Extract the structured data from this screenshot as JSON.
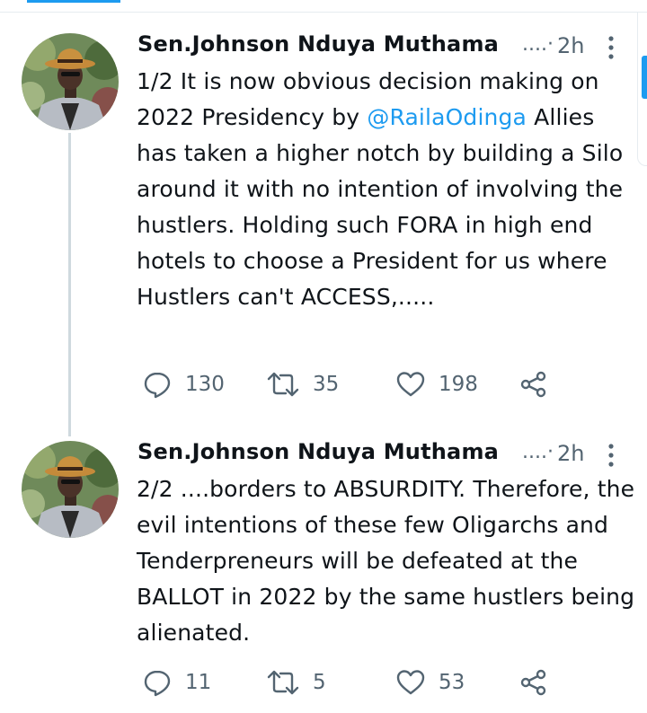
{
  "colors": {
    "accent": "#1d9bf0",
    "muted": "#536471",
    "text": "#0f1419",
    "thread_line": "#cfd9de"
  },
  "tweets": [
    {
      "author": "Sen.Johnson Nduya Muthama",
      "ellipsis": "....",
      "separator": "·",
      "time": "2h",
      "text_before": "1/2 It is now obvious decision making on 2022 Presidency by ",
      "mention": "@RailaOdinga",
      "text_after": " Allies has taken a higher notch by building a Silo around it with no intention of involving the hustlers. Holding such FORA in high end hotels to choose a President for us where Hustlers can't ACCESS,.....",
      "replies": "130",
      "retweets": "35",
      "likes": "198",
      "icons": [
        "reply-icon",
        "retweet-icon",
        "heart-icon",
        "share-icon",
        "more-vertical-icon"
      ]
    },
    {
      "author": "Sen.Johnson Nduya Muthama",
      "ellipsis": "....",
      "separator": "·",
      "time": "2h",
      "text_before": "2/2 ....borders to ABSURDITY. Therefore, the evil intentions of these few Oligarchs and Tenderpreneurs will be defeated at the BALLOT in 2022  by the same hustlers being alienated.",
      "mention": "",
      "text_after": "",
      "replies": "11",
      "retweets": "5",
      "likes": "53",
      "icons": [
        "reply-icon",
        "retweet-icon",
        "heart-icon",
        "share-icon",
        "more-vertical-icon"
      ]
    }
  ]
}
